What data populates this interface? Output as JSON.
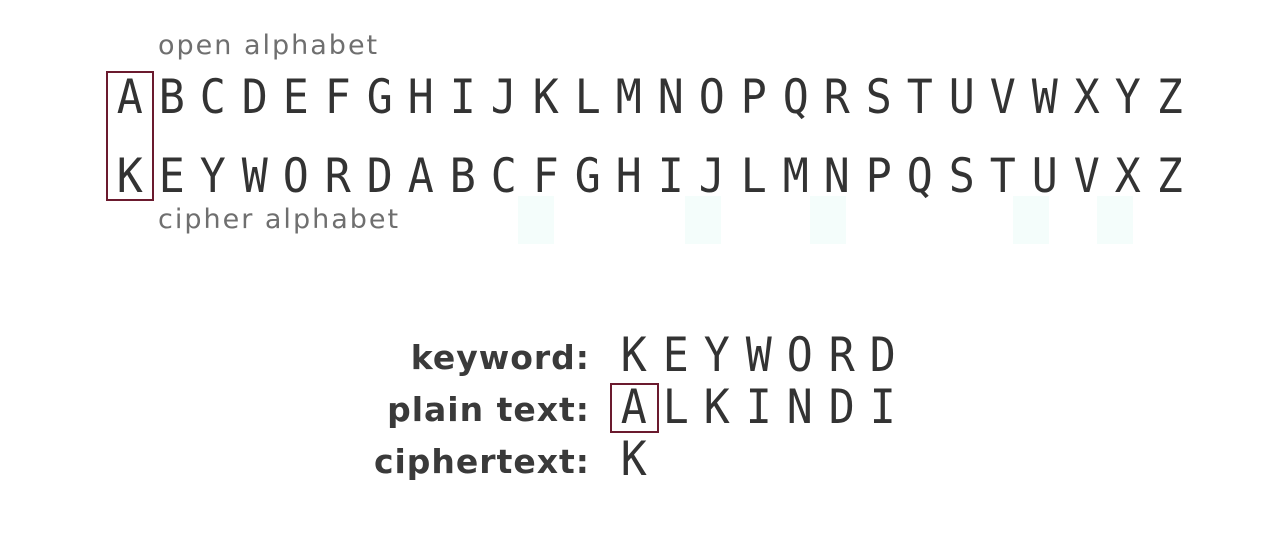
{
  "captions": {
    "open": "open alphabet",
    "cipher": "cipher alphabet"
  },
  "open_alphabet": [
    "A",
    "B",
    "C",
    "D",
    "E",
    "F",
    "G",
    "H",
    "I",
    "J",
    "K",
    "L",
    "M",
    "N",
    "O",
    "P",
    "Q",
    "R",
    "S",
    "T",
    "U",
    "V",
    "W",
    "X",
    "Y",
    "Z"
  ],
  "cipher_alphabet": [
    "K",
    "E",
    "Y",
    "W",
    "O",
    "R",
    "D",
    "A",
    "B",
    "C",
    "F",
    "G",
    "H",
    "I",
    "J",
    "L",
    "M",
    "N",
    "P",
    "Q",
    "S",
    "T",
    "U",
    "V",
    "X",
    "Z"
  ],
  "labels": {
    "keyword": "keyword:",
    "plain_text": "plain text:",
    "ciphertext": "ciphertext:"
  },
  "keyword": [
    "K",
    "E",
    "Y",
    "W",
    "O",
    "R",
    "D"
  ],
  "plain_text": [
    "A",
    "L",
    "K",
    "I",
    "N",
    "D",
    "I"
  ],
  "ciphertext": [
    "K"
  ],
  "highlight": {
    "column_index": 0,
    "color": "#6b1a2e"
  },
  "colors": {
    "letters": "#333333",
    "captions": "#6f6f6f",
    "labels": "#3a3a3a"
  }
}
